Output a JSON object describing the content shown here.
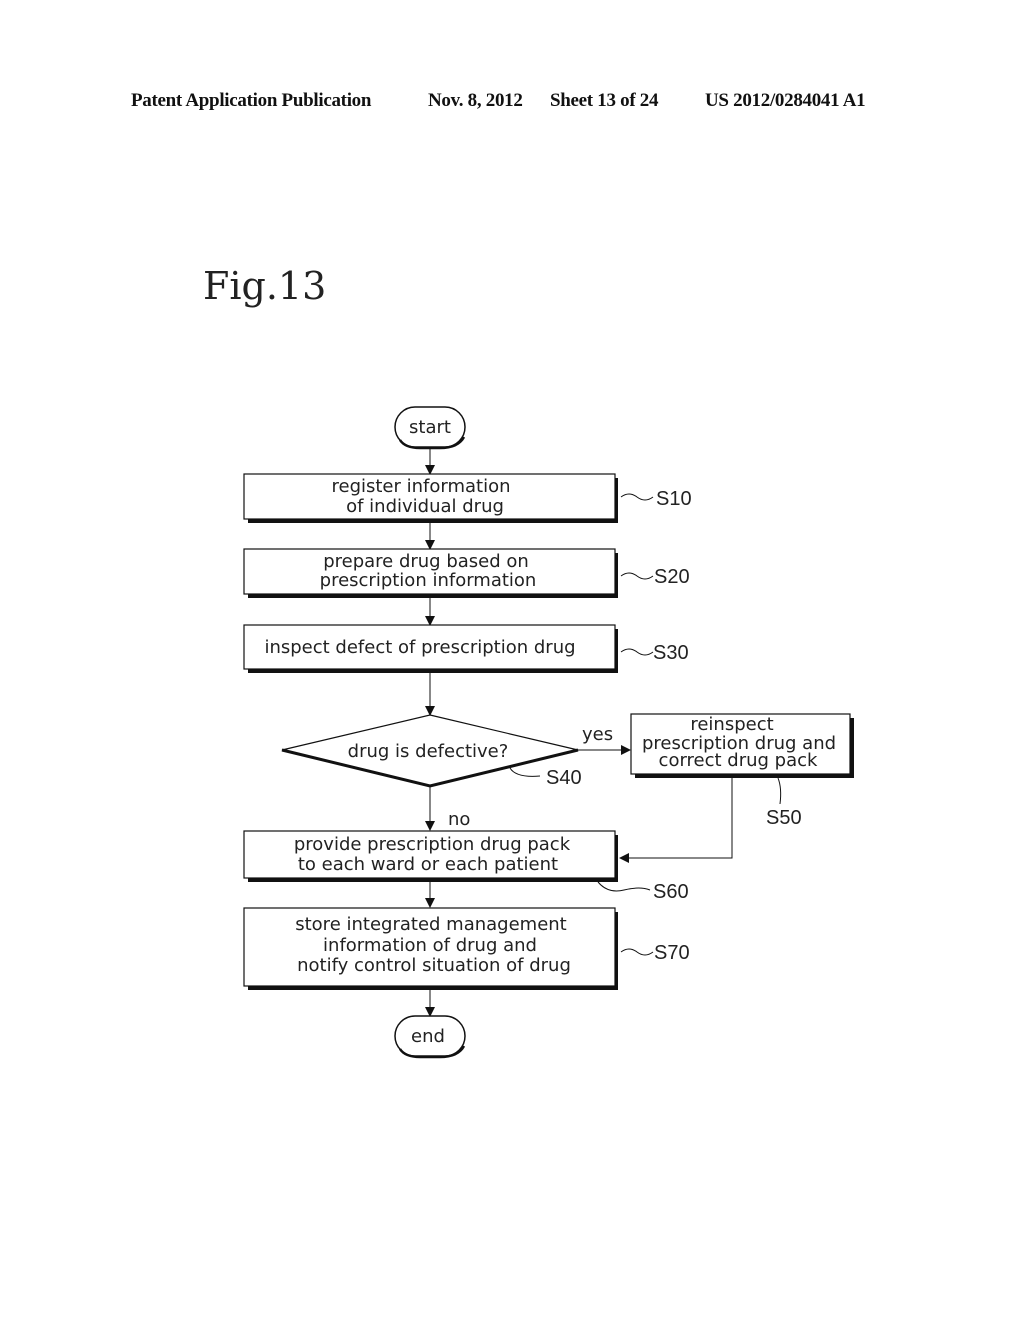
{
  "header": {
    "publication": "Patent Application Publication",
    "date": "Nov. 8, 2012",
    "sheet": "Sheet 13 of 24",
    "number": "US 2012/0284041 A1"
  },
  "figure": {
    "label": "Fig.13"
  },
  "flowchart": {
    "start": "start",
    "end": "end",
    "steps": {
      "s10": {
        "lines": [
          "register information",
          "of individual drug"
        ],
        "ref": "S10"
      },
      "s20": {
        "lines": [
          "prepare drug based on",
          "prescription information"
        ],
        "ref": "S20"
      },
      "s30": {
        "lines": [
          "inspect defect of prescription drug"
        ],
        "ref": "S30"
      },
      "s40": {
        "lines": [
          "drug is defective?"
        ],
        "ref": "S40"
      },
      "s50": {
        "lines": [
          "reinspect",
          "prescription drug and",
          "correct drug pack"
        ],
        "ref": "S50"
      },
      "s60": {
        "lines": [
          "provide prescription drug pack",
          "to each ward or each patient"
        ],
        "ref": "S60"
      },
      "s70": {
        "lines": [
          "store integrated management",
          "information of drug and",
          "notify control situation of drug"
        ],
        "ref": "S70"
      }
    },
    "branch_yes": "yes",
    "branch_no": "no"
  }
}
